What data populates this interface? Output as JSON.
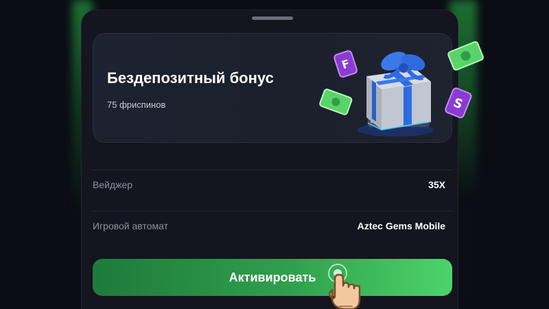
{
  "bonus": {
    "title": "Бездепозитный бонус",
    "subtitle": "75 фриспинов"
  },
  "details": [
    {
      "label": "Вейджер",
      "value": "35X"
    },
    {
      "label": "Игровой автомат",
      "value": "Aztec Gems Mobile"
    }
  ],
  "action": {
    "label": "Активировать"
  },
  "colors": {
    "background": "#0b0c14",
    "sheet": "#14151f",
    "card": "#1d2230",
    "button_start": "#1e7a3a",
    "button_end": "#4cd46a",
    "accent_blue": "#2f6be0",
    "accent_green": "#3ccf5b",
    "accent_purple": "#8a3bd1"
  },
  "icons": [
    "gift-icon",
    "cash-note-icon",
    "slot-card-icon",
    "pointing-hand-icon"
  ]
}
